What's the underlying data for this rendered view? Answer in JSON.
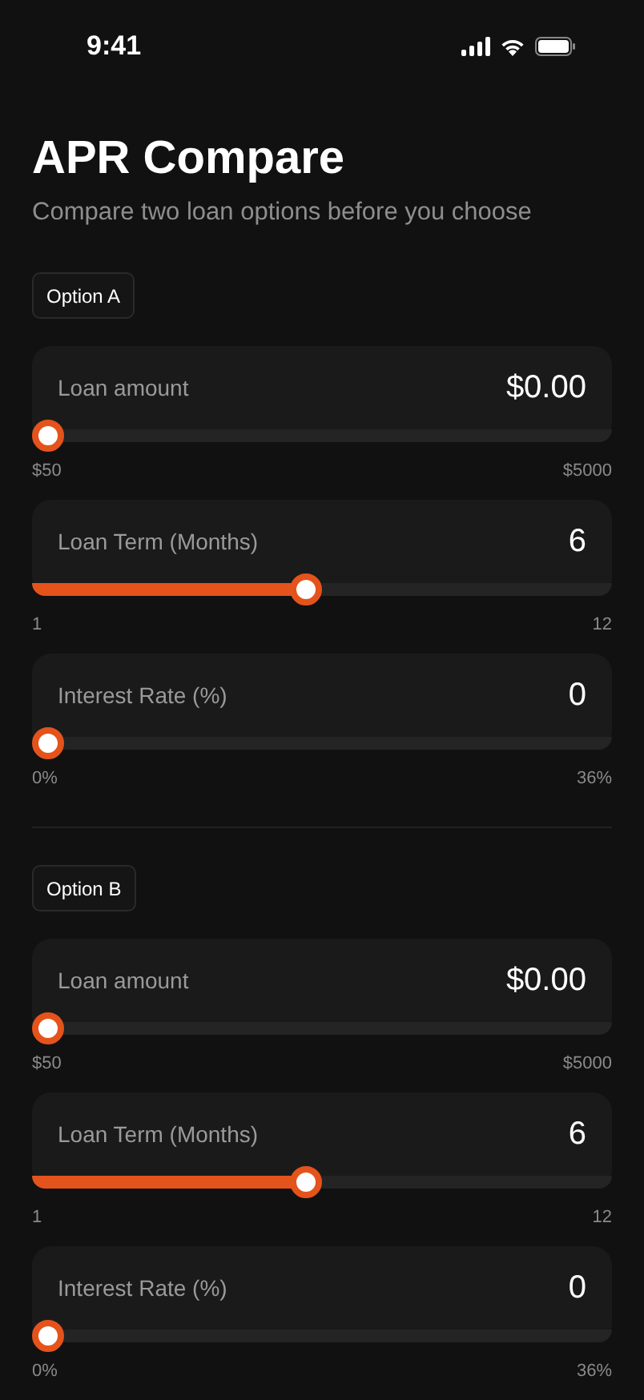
{
  "status_bar": {
    "time": "9:41"
  },
  "header": {
    "title": "APR Compare",
    "subtitle": "Compare two loan options before you choose"
  },
  "options": [
    {
      "label": "Option A",
      "fields": [
        {
          "label": "Loan amount",
          "value": "$0.00",
          "level": 0,
          "min_label": "$50",
          "max_label": "$5000"
        },
        {
          "label": "Loan Term (Months)",
          "value": "6",
          "level": 0.47,
          "min_label": "1",
          "max_label": "12"
        },
        {
          "label": "Interest Rate (%)",
          "value": "0",
          "level": 0,
          "min_label": "0%",
          "max_label": "36%"
        }
      ]
    },
    {
      "label": "Option B",
      "fields": [
        {
          "label": "Loan amount",
          "value": "$0.00",
          "level": 0,
          "min_label": "$50",
          "max_label": "$5000"
        },
        {
          "label": "Loan Term (Months)",
          "value": "6",
          "level": 0.47,
          "min_label": "1",
          "max_label": "12"
        },
        {
          "label": "Interest Rate (%)",
          "value": "0",
          "level": 0,
          "min_label": "0%",
          "max_label": "36%"
        }
      ]
    }
  ]
}
